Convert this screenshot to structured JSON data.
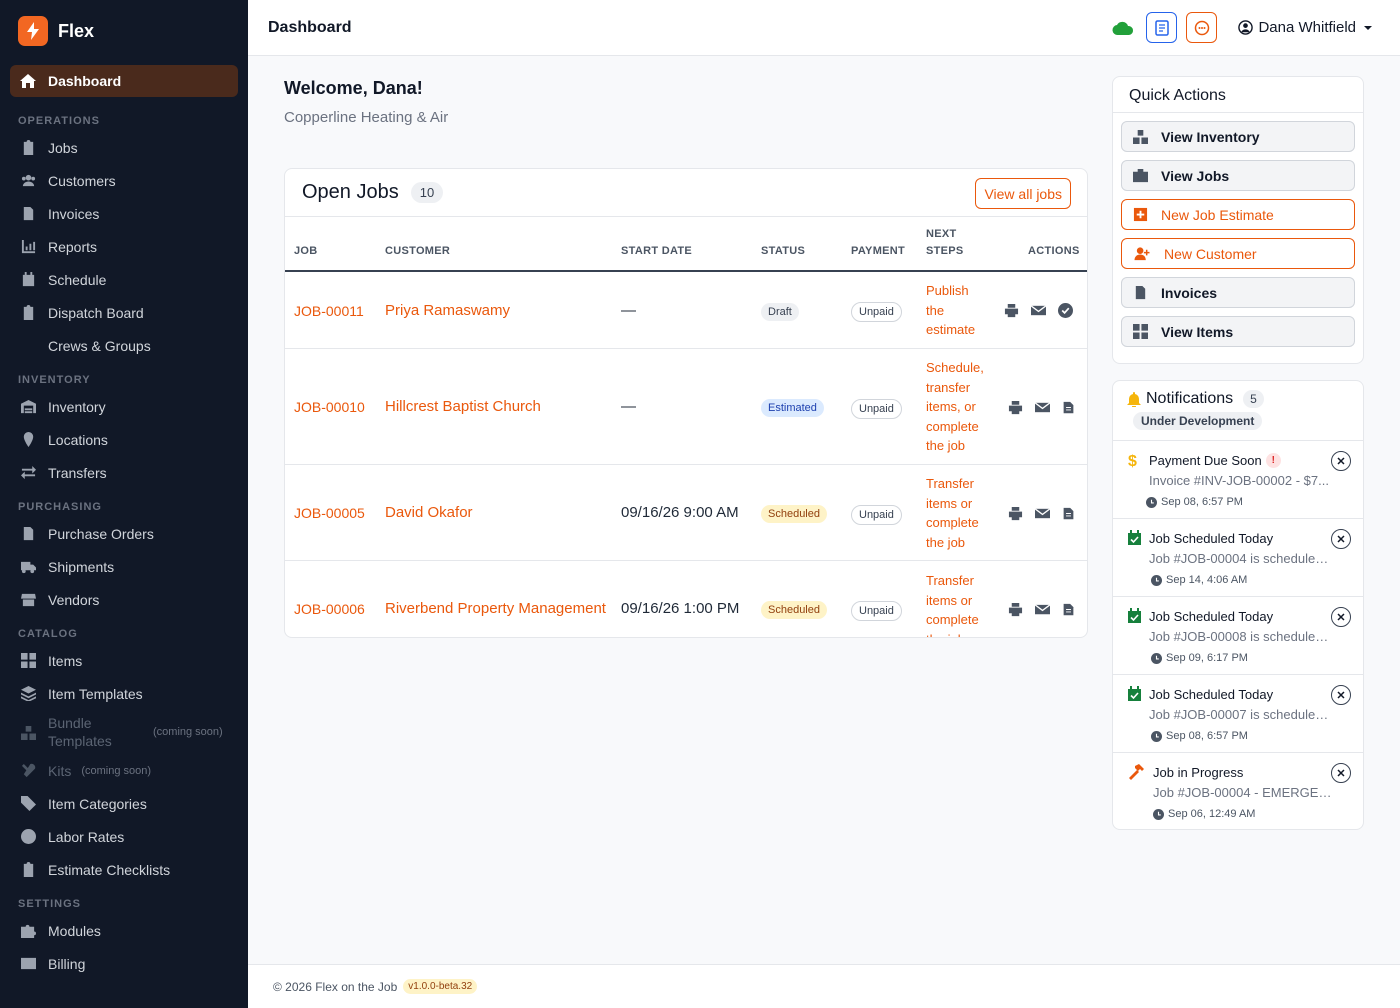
{
  "app": {
    "name": "Flex",
    "accent": "#f26722"
  },
  "sidebar": {
    "active": {
      "label": "Dashboard",
      "icon": "home-icon"
    },
    "sections": [
      {
        "title": "OPERATIONS",
        "items": [
          {
            "label": "Jobs"
          },
          {
            "label": "Customers"
          },
          {
            "label": "Invoices"
          },
          {
            "label": "Reports"
          },
          {
            "label": "Schedule"
          },
          {
            "label": "Dispatch Board"
          },
          {
            "label": "Crews & Groups"
          }
        ]
      },
      {
        "title": "INVENTORY",
        "items": [
          {
            "label": "Inventory"
          },
          {
            "label": "Locations"
          },
          {
            "label": "Transfers"
          }
        ]
      },
      {
        "title": "PURCHASING",
        "items": [
          {
            "label": "Purchase Orders"
          },
          {
            "label": "Shipments"
          },
          {
            "label": "Vendors"
          }
        ]
      },
      {
        "title": "CATALOG",
        "items": [
          {
            "label": "Items"
          },
          {
            "label": "Item Templates"
          },
          {
            "label": "Bundle Templates",
            "note": "(coming soon)"
          },
          {
            "label": "Kits",
            "note": "(coming soon)"
          },
          {
            "label": "Item Categories"
          },
          {
            "label": "Labor Rates"
          },
          {
            "label": "Estimate Checklists"
          }
        ]
      },
      {
        "title": "SETTINGS",
        "items": [
          {
            "label": "Modules"
          },
          {
            "label": "Billing"
          }
        ]
      }
    ]
  },
  "topbar": {
    "title": "Dashboard",
    "user": "Dana Whitfield"
  },
  "main": {
    "welcome": "Welcome, Dana!",
    "company": "Copperline Heating & Air",
    "open_jobs": {
      "title": "Open Jobs",
      "count": "10",
      "view_all": "View all jobs",
      "headers": {
        "job": "JOB",
        "customer": "CUSTOMER",
        "start": "START DATE",
        "status": "STATUS",
        "payment": "PAYMENT",
        "next1": "NEXT",
        "next2": "STEPS",
        "actions": "ACTIONS"
      },
      "rows": [
        {
          "job": "JOB-00011",
          "customer": "Priya Ramaswamy",
          "start": "—",
          "status": "Draft",
          "payment": "Unpaid",
          "next": "Publish the estimate"
        },
        {
          "job": "JOB-00010",
          "customer": "Hillcrest Baptist Church",
          "start": "—",
          "status": "Estimated",
          "payment": "Unpaid",
          "next": "Schedule, transfer items, or complete the job"
        },
        {
          "job": "JOB-00005",
          "customer": "David Okafor",
          "start": "09/16/26 9:00 AM",
          "status": "Scheduled",
          "payment": "Unpaid",
          "next": "Transfer items or complete the job"
        },
        {
          "job": "JOB-00006",
          "customer": "Riverbend Property Management",
          "start": "09/16/26 1:00 PM",
          "status": "Scheduled",
          "payment": "Unpaid",
          "next": "Transfer items or complete the job"
        }
      ]
    }
  },
  "quick_actions": {
    "title": "Quick Actions",
    "items": [
      {
        "label": "View Inventory"
      },
      {
        "label": "View Jobs"
      },
      {
        "label": "New Job Estimate"
      },
      {
        "label": "New Customer"
      },
      {
        "label": "Invoices"
      },
      {
        "label": "View Items"
      }
    ]
  },
  "notifications": {
    "title": "Notifications",
    "count": "5",
    "badge": "Under Development",
    "items": [
      {
        "title": "Payment Due Soon",
        "desc": "Invoice #INV-JOB-00002 - $7...",
        "time": "Sep 08, 6:57 PM",
        "icon": "dollar-icon"
      },
      {
        "title": "Job Scheduled Today",
        "desc": "Job #JOB-00004 is scheduled...",
        "time": "Sep 14, 4:06 AM",
        "icon": "calendar-check-icon"
      },
      {
        "title": "Job Scheduled Today",
        "desc": "Job #JOB-00008 is scheduled...",
        "time": "Sep 09, 6:17 PM",
        "icon": "calendar-check-icon"
      },
      {
        "title": "Job Scheduled Today",
        "desc": "Job #JOB-00007 is scheduled...",
        "time": "Sep 08, 6:57 PM",
        "icon": "calendar-check-icon"
      },
      {
        "title": "Job in Progress",
        "desc": "Job #JOB-00004 - EMERGEN...",
        "time": "Sep 06, 12:49 AM",
        "icon": "hammer-icon"
      }
    ]
  },
  "footer": {
    "copyright": "© 2026 Flex on the Job",
    "version": "v1.0.0-beta.32"
  }
}
